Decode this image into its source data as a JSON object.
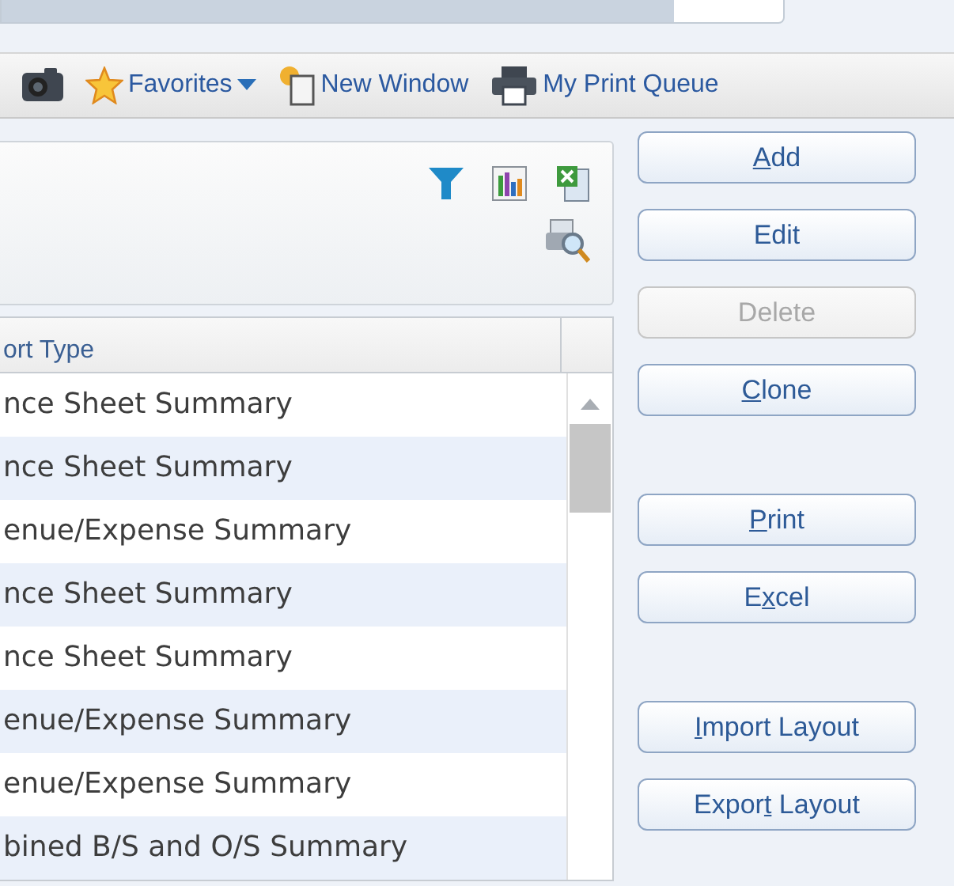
{
  "toolbar": {
    "items": [
      {
        "kind": "camera"
      },
      {
        "kind": "favorites",
        "label": "Favorites",
        "dropdown": true
      },
      {
        "kind": "window",
        "label": "New Window",
        "dropdown": false
      },
      {
        "kind": "printer",
        "label": "My Print Queue",
        "dropdown": false
      }
    ]
  },
  "grid": {
    "column": "ort Type",
    "rows": [
      {
        "cell": "nce Sheet Summary"
      },
      {
        "cell": "nce Sheet Summary"
      },
      {
        "cell": "enue/Expense Summary"
      },
      {
        "cell": "nce Sheet Summary"
      },
      {
        "cell": "nce Sheet Summary"
      },
      {
        "cell": "enue/Expense Summary"
      },
      {
        "cell": "enue/Expense Summary"
      },
      {
        "cell": "bined B/S and O/S Summary"
      }
    ]
  },
  "button_groups": [
    [
      {
        "key": "A",
        "after": "dd",
        "disabled": false
      },
      {
        "before": "Edit",
        "disabled": false
      },
      {
        "before": "Delete",
        "disabled": true
      },
      {
        "key": "C",
        "after": "lone",
        "disabled": false
      }
    ],
    [
      {
        "key": "P",
        "after": "rint",
        "disabled": false
      },
      {
        "before": "E",
        "key": "x",
        "after": "cel",
        "disabled": false
      }
    ],
    [
      {
        "key": "I",
        "after": "mport Layout",
        "disabled": false
      },
      {
        "before": "Expor",
        "key": "t",
        "after": " Layout",
        "disabled": false
      }
    ]
  ]
}
